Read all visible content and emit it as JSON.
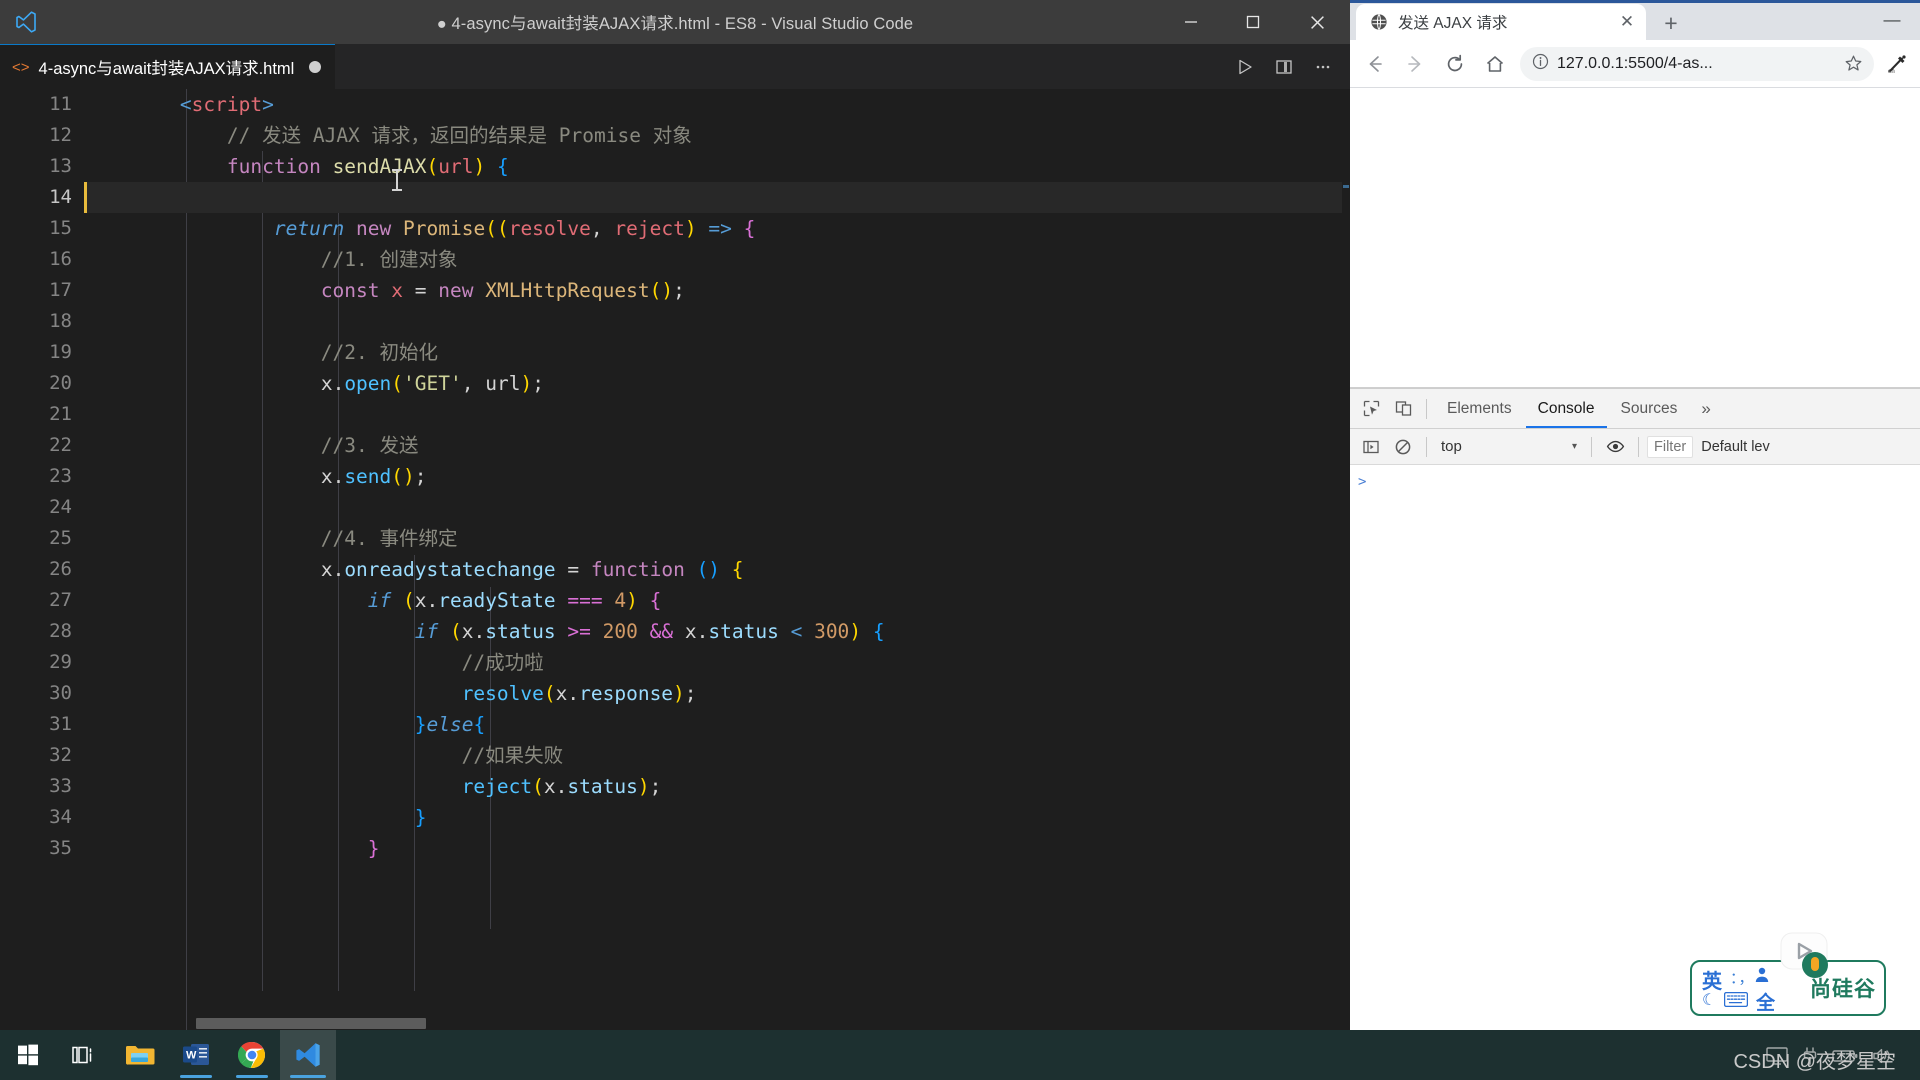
{
  "vscode": {
    "window_title": "● 4-async与await封装AJAX请求.html - ES8 - Visual Studio Code",
    "logo_name": "vscode-logo",
    "window_controls": {
      "minimize": "—",
      "maximize": "□",
      "close": "✕"
    },
    "tab": {
      "label": "4-async与await封装AJAX请求.html",
      "icon": "html-file-icon",
      "dirty": true
    },
    "editor_actions": {
      "run": "run-code-icon",
      "split": "split-editor-icon",
      "more": "more-actions-icon"
    },
    "code": {
      "first_line_number": 11,
      "active_line": 14,
      "lines": [
        {
          "n": 11,
          "tokens": [
            {
              "t": "        ",
              "c": "t-plain"
            },
            {
              "t": "<",
              "c": "t-tag"
            },
            {
              "t": "script",
              "c": "t-tagname"
            },
            {
              "t": ">",
              "c": "t-tag"
            }
          ]
        },
        {
          "n": 12,
          "tokens": [
            {
              "t": "            // 发送 AJAX 请求，返回的结果是 Promise 对象",
              "c": "t-cmt-gray"
            }
          ]
        },
        {
          "n": 13,
          "tokens": [
            {
              "t": "            ",
              "c": "t-plain"
            },
            {
              "t": "function ",
              "c": "t-kw"
            },
            {
              "t": "sendAJAX",
              "c": "t-fn"
            },
            {
              "t": "(",
              "c": "t-br1"
            },
            {
              "t": "url",
              "c": "t-param"
            },
            {
              "t": ")",
              "c": "t-br1"
            },
            {
              "t": " ",
              "c": "t-plain"
            },
            {
              "t": "{",
              "c": "t-br3"
            }
          ]
        },
        {
          "n": 14,
          "tokens": [
            {
              "t": "",
              "c": "t-plain"
            }
          ]
        },
        {
          "n": 15,
          "tokens": [
            {
              "t": "                ",
              "c": "t-plain"
            },
            {
              "t": "return",
              "c": "t-ctrl"
            },
            {
              "t": " ",
              "c": "t-plain"
            },
            {
              "t": "new",
              "c": "t-kw"
            },
            {
              "t": " ",
              "c": "t-plain"
            },
            {
              "t": "Promise",
              "c": "t-type"
            },
            {
              "t": "((",
              "c": "t-br1"
            },
            {
              "t": "resolve",
              "c": "t-param"
            },
            {
              "t": ", ",
              "c": "t-plain"
            },
            {
              "t": "reject",
              "c": "t-param"
            },
            {
              "t": ")",
              "c": "t-br1"
            },
            {
              "t": " ",
              "c": "t-plain"
            },
            {
              "t": "=>",
              "c": "t-kwblue"
            },
            {
              "t": " ",
              "c": "t-plain"
            },
            {
              "t": "{",
              "c": "t-br2"
            }
          ]
        },
        {
          "n": 16,
          "tokens": [
            {
              "t": "                    //1. 创建对象",
              "c": "t-cmt-gray"
            }
          ]
        },
        {
          "n": 17,
          "tokens": [
            {
              "t": "                    ",
              "c": "t-plain"
            },
            {
              "t": "const",
              "c": "t-kw"
            },
            {
              "t": " ",
              "c": "t-plain"
            },
            {
              "t": "x",
              "c": "t-param"
            },
            {
              "t": " ",
              "c": "t-plain"
            },
            {
              "t": "=",
              "c": "t-op"
            },
            {
              "t": " ",
              "c": "t-plain"
            },
            {
              "t": "new",
              "c": "t-kw"
            },
            {
              "t": " ",
              "c": "t-plain"
            },
            {
              "t": "XMLHttpRequest",
              "c": "t-type"
            },
            {
              "t": "()",
              "c": "t-br1"
            },
            {
              "t": ";",
              "c": "t-plain"
            }
          ]
        },
        {
          "n": 18,
          "tokens": [
            {
              "t": "",
              "c": "t-plain"
            }
          ]
        },
        {
          "n": 19,
          "tokens": [
            {
              "t": "                    //2. 初始化",
              "c": "t-cmt-gray"
            }
          ]
        },
        {
          "n": 20,
          "tokens": [
            {
              "t": "                    ",
              "c": "t-plain"
            },
            {
              "t": "x",
              "c": "t-plain"
            },
            {
              "t": ".",
              "c": "t-plain"
            },
            {
              "t": "open",
              "c": "t-fnblue"
            },
            {
              "t": "(",
              "c": "t-br1"
            },
            {
              "t": "'GET'",
              "c": "t-strg"
            },
            {
              "t": ", ",
              "c": "t-plain"
            },
            {
              "t": "url",
              "c": "t-plain"
            },
            {
              "t": ")",
              "c": "t-br1"
            },
            {
              "t": ";",
              "c": "t-plain"
            }
          ]
        },
        {
          "n": 21,
          "tokens": [
            {
              "t": "",
              "c": "t-plain"
            }
          ]
        },
        {
          "n": 22,
          "tokens": [
            {
              "t": "                    //3. 发送",
              "c": "t-cmt-gray"
            }
          ]
        },
        {
          "n": 23,
          "tokens": [
            {
              "t": "                    ",
              "c": "t-plain"
            },
            {
              "t": "x",
              "c": "t-plain"
            },
            {
              "t": ".",
              "c": "t-plain"
            },
            {
              "t": "send",
              "c": "t-fnblue"
            },
            {
              "t": "()",
              "c": "t-br1"
            },
            {
              "t": ";",
              "c": "t-plain"
            }
          ]
        },
        {
          "n": 24,
          "tokens": [
            {
              "t": "",
              "c": "t-plain"
            }
          ]
        },
        {
          "n": 25,
          "tokens": [
            {
              "t": "                    //4. 事件绑定",
              "c": "t-cmt-gray"
            }
          ]
        },
        {
          "n": 26,
          "tokens": [
            {
              "t": "                    ",
              "c": "t-plain"
            },
            {
              "t": "x",
              "c": "t-plain"
            },
            {
              "t": ".",
              "c": "t-plain"
            },
            {
              "t": "onreadystatechange",
              "c": "t-var"
            },
            {
              "t": " ",
              "c": "t-plain"
            },
            {
              "t": "=",
              "c": "t-op"
            },
            {
              "t": " ",
              "c": "t-plain"
            },
            {
              "t": "function",
              "c": "t-kw"
            },
            {
              "t": " ",
              "c": "t-plain"
            },
            {
              "t": "()",
              "c": "t-br3"
            },
            {
              "t": " ",
              "c": "t-plain"
            },
            {
              "t": "{",
              "c": "t-br1"
            }
          ]
        },
        {
          "n": 27,
          "tokens": [
            {
              "t": "                        ",
              "c": "t-plain"
            },
            {
              "t": "if",
              "c": "t-ctrl"
            },
            {
              "t": " ",
              "c": "t-plain"
            },
            {
              "t": "(",
              "c": "t-br1"
            },
            {
              "t": "x",
              "c": "t-plain"
            },
            {
              "t": ".",
              "c": "t-plain"
            },
            {
              "t": "readyState",
              "c": "t-var"
            },
            {
              "t": " ",
              "c": "t-plain"
            },
            {
              "t": "===",
              "c": "t-br2"
            },
            {
              "t": " ",
              "c": "t-plain"
            },
            {
              "t": "4",
              "c": "t-numor"
            },
            {
              "t": ")",
              "c": "t-br1"
            },
            {
              "t": " ",
              "c": "t-plain"
            },
            {
              "t": "{",
              "c": "t-br2"
            }
          ]
        },
        {
          "n": 28,
          "tokens": [
            {
              "t": "                            ",
              "c": "t-plain"
            },
            {
              "t": "if",
              "c": "t-ctrl"
            },
            {
              "t": " ",
              "c": "t-plain"
            },
            {
              "t": "(",
              "c": "t-br1"
            },
            {
              "t": "x",
              "c": "t-plain"
            },
            {
              "t": ".",
              "c": "t-plain"
            },
            {
              "t": "status",
              "c": "t-var"
            },
            {
              "t": " ",
              "c": "t-plain"
            },
            {
              "t": ">=",
              "c": "t-br2"
            },
            {
              "t": " ",
              "c": "t-plain"
            },
            {
              "t": "200",
              "c": "t-numor"
            },
            {
              "t": " ",
              "c": "t-plain"
            },
            {
              "t": "&&",
              "c": "t-br2"
            },
            {
              "t": " ",
              "c": "t-plain"
            },
            {
              "t": "x",
              "c": "t-plain"
            },
            {
              "t": ".",
              "c": "t-plain"
            },
            {
              "t": "status",
              "c": "t-var"
            },
            {
              "t": " ",
              "c": "t-plain"
            },
            {
              "t": "<",
              "c": "t-kwblue"
            },
            {
              "t": " ",
              "c": "t-plain"
            },
            {
              "t": "300",
              "c": "t-numor"
            },
            {
              "t": ")",
              "c": "t-br1"
            },
            {
              "t": " ",
              "c": "t-plain"
            },
            {
              "t": "{",
              "c": "t-br3"
            }
          ]
        },
        {
          "n": 29,
          "tokens": [
            {
              "t": "                                //成功啦",
              "c": "t-cmt-gray"
            }
          ]
        },
        {
          "n": 30,
          "tokens": [
            {
              "t": "                                ",
              "c": "t-plain"
            },
            {
              "t": "resolve",
              "c": "t-fnblue"
            },
            {
              "t": "(",
              "c": "t-br1"
            },
            {
              "t": "x",
              "c": "t-plain"
            },
            {
              "t": ".",
              "c": "t-plain"
            },
            {
              "t": "response",
              "c": "t-var"
            },
            {
              "t": ")",
              "c": "t-br1"
            },
            {
              "t": ";",
              "c": "t-plain"
            }
          ]
        },
        {
          "n": 31,
          "tokens": [
            {
              "t": "                            ",
              "c": "t-plain"
            },
            {
              "t": "}",
              "c": "t-br3"
            },
            {
              "t": "else",
              "c": "t-ctrl"
            },
            {
              "t": "{",
              "c": "t-br3"
            }
          ]
        },
        {
          "n": 32,
          "tokens": [
            {
              "t": "                                //如果失败",
              "c": "t-cmt-gray"
            }
          ]
        },
        {
          "n": 33,
          "tokens": [
            {
              "t": "                                ",
              "c": "t-plain"
            },
            {
              "t": "reject",
              "c": "t-fnblue"
            },
            {
              "t": "(",
              "c": "t-br1"
            },
            {
              "t": "x",
              "c": "t-plain"
            },
            {
              "t": ".",
              "c": "t-plain"
            },
            {
              "t": "status",
              "c": "t-var"
            },
            {
              "t": ")",
              "c": "t-br1"
            },
            {
              "t": ";",
              "c": "t-plain"
            }
          ]
        },
        {
          "n": 34,
          "tokens": [
            {
              "t": "                            ",
              "c": "t-plain"
            },
            {
              "t": "}",
              "c": "t-br3"
            }
          ]
        },
        {
          "n": 35,
          "tokens": [
            {
              "t": "                        ",
              "c": "t-plain"
            },
            {
              "t": "}",
              "c": "t-br2"
            }
          ]
        }
      ]
    }
  },
  "chrome": {
    "tab": {
      "title": "发送 AJAX 请求",
      "favicon": "globe-icon",
      "close": "✕"
    },
    "new_tab_label": "+",
    "window_minimize": "—",
    "toolbar": {
      "back": "back-arrow-icon",
      "forward": "forward-arrow-icon",
      "reload": "reload-icon",
      "home": "home-icon",
      "info": "site-info-icon",
      "url": "127.0.0.1:5500/4-as...",
      "bookmark": "star-icon",
      "profile": "profile-icon"
    },
    "devtools": {
      "inspect_icon": "inspect-element-icon",
      "device_icon": "device-toolbar-icon",
      "tabs": [
        {
          "label": "Elements",
          "active": false
        },
        {
          "label": "Console",
          "active": true
        },
        {
          "label": "Sources",
          "active": false
        }
      ],
      "more_tabs": "»",
      "sidebar_toggle_icon": "console-sidebar-icon",
      "clear_icon": "clear-console-icon",
      "context": "top",
      "context_caret": "▾",
      "eye_icon": "live-expression-icon",
      "filter_placeholder": "Filter",
      "level": "Default lev",
      "prompt_symbol": ">"
    }
  },
  "ime": {
    "lang": "英",
    "dots": "：，",
    "person_icon": "user-icon",
    "moon": "☾",
    "keyboard_icon": "keyboard-icon",
    "full_width": "全",
    "brand": "尚硅谷",
    "badge_icon": "video-play-badge"
  },
  "taskbar": {
    "items": [
      {
        "name": "start-button",
        "icon": "windows-logo",
        "state": ""
      },
      {
        "name": "task-view",
        "icon": "task-view-icon",
        "state": ""
      },
      {
        "name": "file-explorer",
        "icon": "folder-icon",
        "state": ""
      },
      {
        "name": "word",
        "icon": "word-icon",
        "state": "running"
      },
      {
        "name": "chrome",
        "icon": "chrome-icon",
        "state": "running"
      },
      {
        "name": "vscode",
        "icon": "vscode-icon",
        "state": "active"
      }
    ],
    "watermark": "CSDN @夜梦星空",
    "tray": [
      "monitor-icon",
      "plug-icon",
      "battery-icon",
      "volume-icon"
    ]
  }
}
